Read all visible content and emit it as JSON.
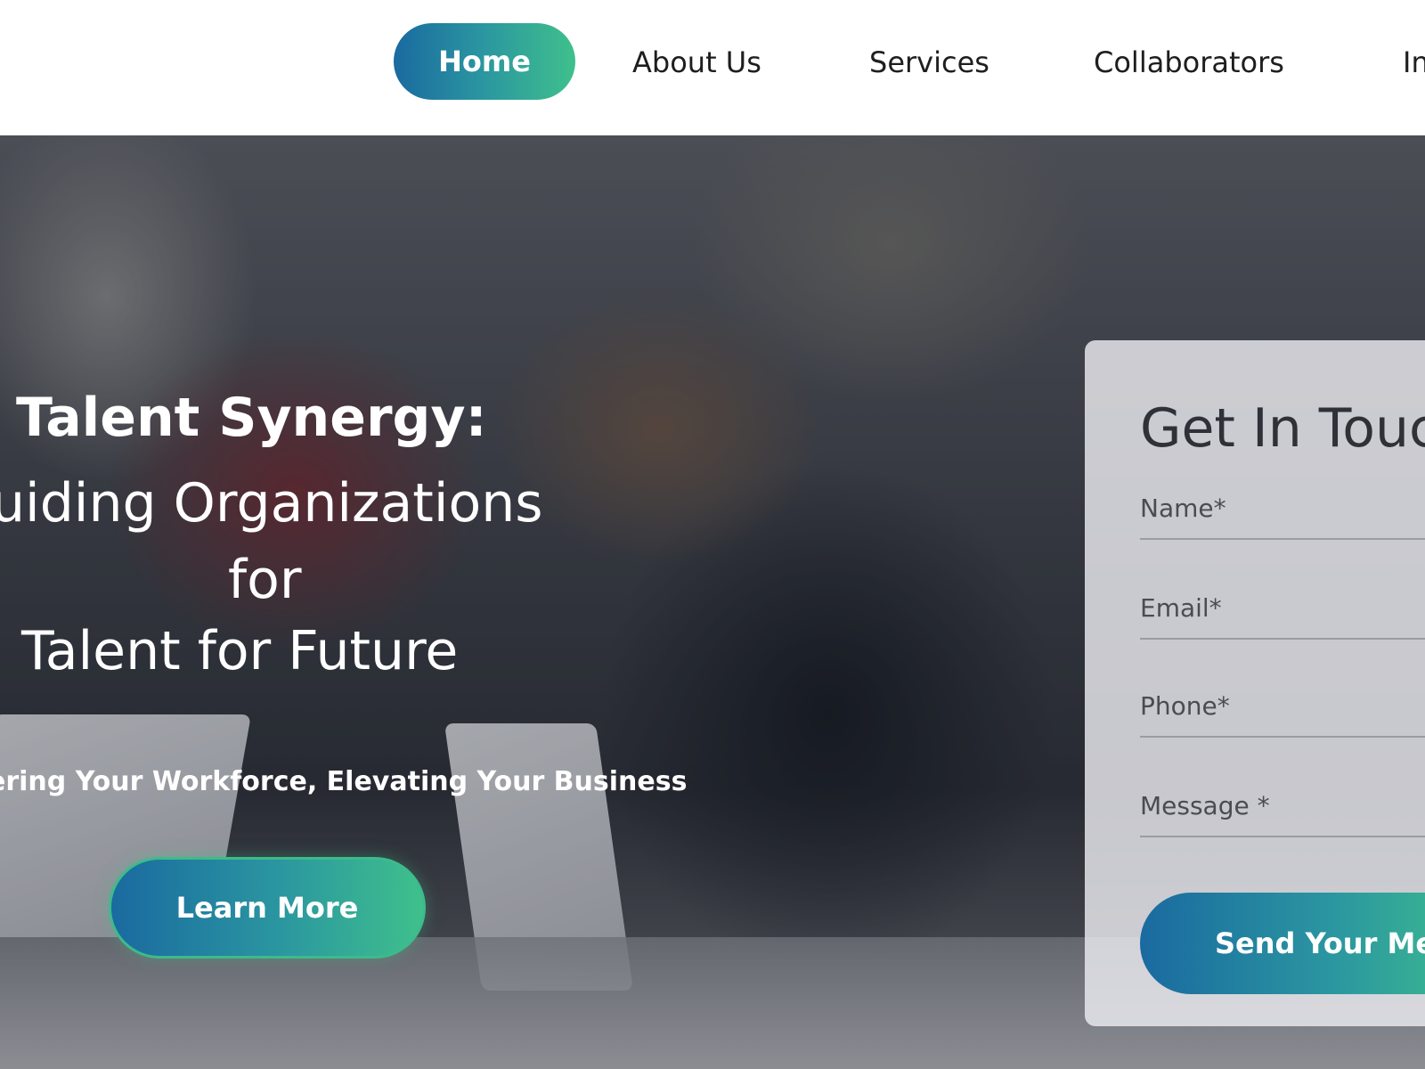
{
  "nav": {
    "items": [
      {
        "label": "Home",
        "active": true
      },
      {
        "label": "About Us"
      },
      {
        "label": "Services"
      },
      {
        "label": "Collaborators"
      },
      {
        "label": "In"
      }
    ]
  },
  "hero": {
    "title_line1": "Talent Synergy:",
    "title_line2": "uiding Organizations",
    "title_line3": "for",
    "title_line4": "Talent for Future",
    "subtitle": "ering Your Workforce, Elevating Your Business",
    "cta_label": "Learn More"
  },
  "contact": {
    "title": "Get In Touc",
    "fields": {
      "name": "Name*",
      "email": "Email*",
      "phone": "Phone*",
      "message": "Message *"
    },
    "submit_label": "Send Your Mes"
  },
  "colors": {
    "gradient_start": "#1a6aa0",
    "gradient_end": "#3fc08c",
    "nav_text": "#1e1e1e",
    "card_bg": "#ebecf0"
  }
}
